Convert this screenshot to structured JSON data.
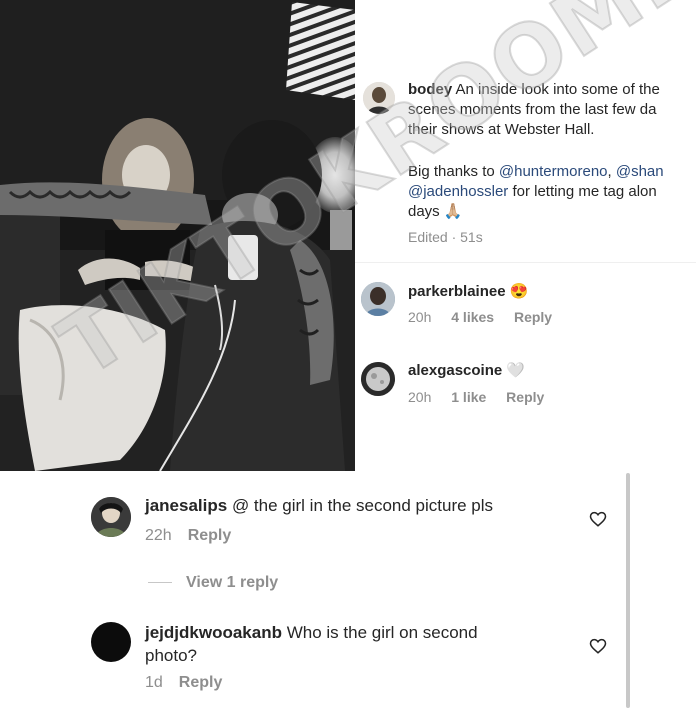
{
  "post": {
    "author": "bodey",
    "caption_line1": "An inside look into some of the",
    "caption_line2": "scenes moments from the last few da",
    "caption_line3": "their shows at Webster Hall.",
    "thanks_prefix": "Big thanks to ",
    "mention1": "@huntermoreno",
    "mention_sep": ", ",
    "mention2": "@shan",
    "mention3": "@jadenhossler",
    "thanks_suffix": " for letting me tag alon",
    "thanks_end": "days",
    "thanks_emoji": "🙏🏼",
    "edited": "Edited · 51s"
  },
  "top_comments": [
    {
      "username": "parkerblainee",
      "text": "😍",
      "time": "20h",
      "likes": "4 likes",
      "reply": "Reply"
    },
    {
      "username": "alexgascoine",
      "text": "🤍",
      "time": "20h",
      "likes": "1 like",
      "reply": "Reply"
    }
  ],
  "bottom_comments": [
    {
      "username": "janesalips",
      "text": "@ the girl in the second picture pls",
      "time": "22h",
      "reply": "Reply",
      "view_replies": "View 1 reply"
    },
    {
      "username": "jejdjdkwooakanb",
      "text_line1": "Who is the girl on second",
      "text_line2": "photo?",
      "time": "1d",
      "reply": "Reply"
    }
  ],
  "watermark": "TIKTOKROOMII",
  "icons": {
    "heart": "heart-outline-icon"
  },
  "colors": {
    "mention": "#2b4a7a",
    "meta_gray": "#8e8e8e",
    "text": "#262626"
  }
}
